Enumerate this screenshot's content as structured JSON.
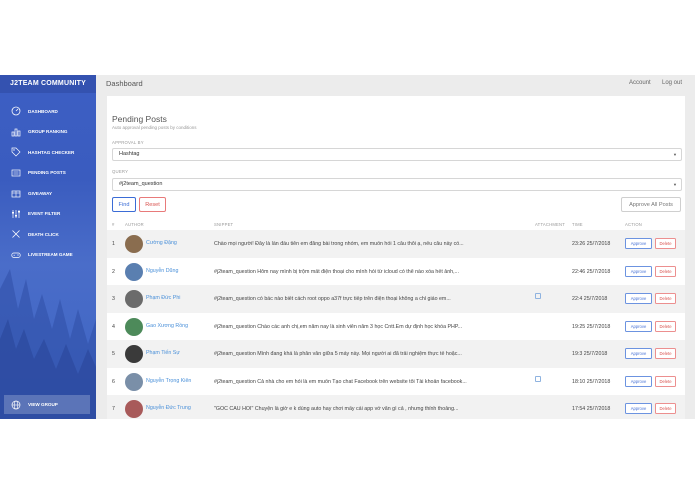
{
  "sidebar": {
    "title": "J2TEAM COMMUNITY",
    "items": [
      {
        "label": "DASHBOARD",
        "icon": "dashboard-icon"
      },
      {
        "label": "GROUP RANKING",
        "icon": "bar-chart-icon"
      },
      {
        "label": "HASHTAG CHECKER",
        "icon": "tag-icon"
      },
      {
        "label": "PENDING POSTS",
        "icon": "document-icon"
      },
      {
        "label": "GIVEAWAY",
        "icon": "gift-icon"
      },
      {
        "label": "EVENT FILTER",
        "icon": "filter-icon"
      },
      {
        "label": "DEATH CLICK",
        "icon": "close-icon"
      },
      {
        "label": "LIVESTREAM GAME",
        "icon": "gamepad-icon"
      }
    ],
    "view_group": {
      "label": "VIEW GROUP",
      "icon": "globe-icon"
    },
    "colors": {
      "bg": "#3d5fc4"
    }
  },
  "header": {
    "breadcrumb": "Dashboard",
    "account": "Account",
    "logout": "Log out"
  },
  "panel": {
    "title": "Pending Posts",
    "subtitle": "Auto approval pending posts by conditions",
    "approval_by": {
      "label": "APPROVAL BY",
      "value": "Hashtag"
    },
    "query": {
      "label": "QUERY",
      "value": "#j2team_question"
    },
    "find_label": "Find",
    "reset_label": "Reset",
    "approve_all_label": "Approve All Posts",
    "table": {
      "headers": {
        "num": "#",
        "author": "AUTHOR",
        "snippet": "SNIPPET",
        "attachment": "ATTACHMENT",
        "time": "TIME",
        "action": "ACTION"
      },
      "approve_label": "Approve",
      "delete_label": "Delete",
      "rows": [
        {
          "num": "1",
          "author": "Cường Đặng",
          "snippet": "Chào mọi người! Đây là lần đầu tiên em đăng bài trong nhóm, em muốn hỏi 1 câu thôi ạ, nếu câu này có...",
          "attachment": false,
          "time": "23:26 25/7/2018"
        },
        {
          "num": "2",
          "author": "Nguyễn Dũng",
          "snippet": "#j2team_question Hôm nay mình bị trộm mất điện thoại cho mình hỏi từ icloud có thể nào xóa hết ảnh,...",
          "attachment": false,
          "time": "22:46 25/7/2018"
        },
        {
          "num": "3",
          "author": "Phạm Đức Phi",
          "snippet": "#j2team_question có bác nào biết cách root oppo a37f trực tiếp trên điện thoại không a chỉ giáo em...",
          "attachment": true,
          "time": "22:4 25/7/2018"
        },
        {
          "num": "4",
          "author": "Gao Xương Rồng",
          "snippet": "#j2team_question Chào các anh chị,em năm nay là sinh viên năm 3 học Cntt.Em dự định học khóa PHP...",
          "attachment": false,
          "time": "19:25 25/7/2018"
        },
        {
          "num": "5",
          "author": "Phạm Tiến Sự",
          "snippet": "#j2team_question Mình đang khá là phân vân giữa 5 máy này. Mọi người ai đã trải nghiệm thực tế hoặc...",
          "attachment": false,
          "time": "19:3 25/7/2018"
        },
        {
          "num": "6",
          "author": "Nguyễn Trọng Kiên",
          "snippet": "#j2team_question Cả nhà cho em hỏi là em muốn Tạo chat Facebook trên website tôi Tài khoản facebook...",
          "attachment": true,
          "time": "18:10 25/7/2018"
        },
        {
          "num": "7",
          "author": "Nguyễn Đức Trung",
          "snippet": "\"GÓC CẦU HỎI\" Chuyện là giờ e k dùng auto hay chơi mấy cái app vớ vẩn gì cả , nhưng thỉnh thoảng...",
          "attachment": false,
          "time": "17:54 25/7/2018"
        }
      ]
    }
  }
}
